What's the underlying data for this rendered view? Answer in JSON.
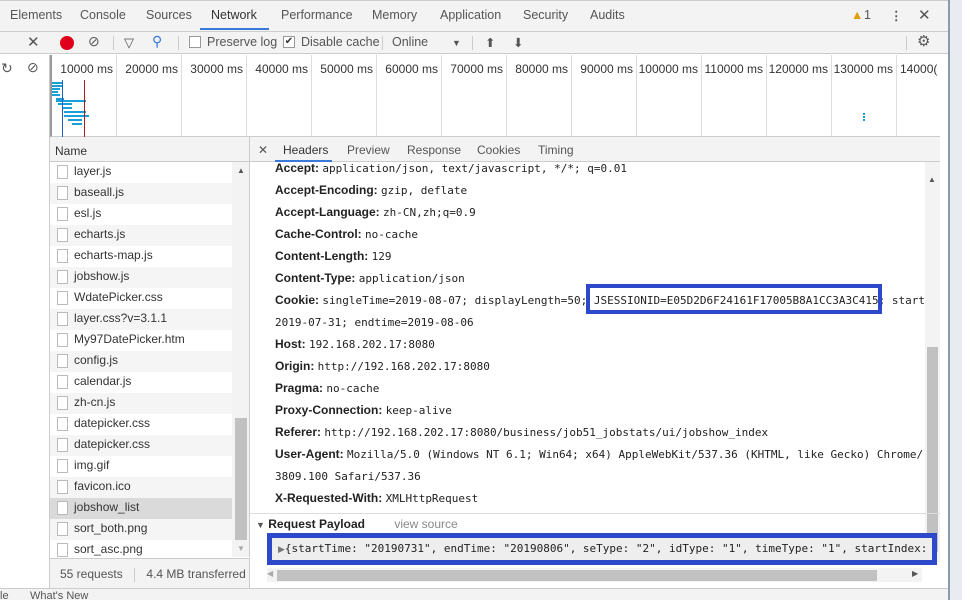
{
  "tabs": [
    "Elements",
    "Console",
    "Sources",
    "Network",
    "Performance",
    "Memory",
    "Application",
    "Security",
    "Audits"
  ],
  "active_tab": "Network",
  "warning_count": "1",
  "toolbar": {
    "preserve_log": "Preserve log",
    "preserve_log_checked": false,
    "disable_cache": "Disable cache",
    "disable_cache_checked": true,
    "throttle": "Online"
  },
  "colors": {
    "accent": "#3879d9",
    "record": "#e0001b",
    "highlight_box": "#2d48c8"
  },
  "timeline_ticks": [
    "10000 ms",
    "20000 ms",
    "30000 ms",
    "40000 ms",
    "50000 ms",
    "60000 ms",
    "70000 ms",
    "80000 ms",
    "90000 ms",
    "100000 ms",
    "110000 ms",
    "120000 ms",
    "130000 ms",
    "14000("
  ],
  "name_header": "Name",
  "requests": [
    "layer.js",
    "baseall.js",
    "esl.js",
    "echarts.js",
    "echarts-map.js",
    "jobshow.js",
    "WdatePicker.css",
    "layer.css?v=3.1.1",
    "My97DatePicker.htm",
    "config.js",
    "calendar.js",
    "zh-cn.js",
    "datepicker.css",
    "datepicker.css",
    "img.gif",
    "favicon.ico",
    "jobshow_list",
    "sort_both.png",
    "sort_asc.png"
  ],
  "selected_request": "jobshow_list",
  "status": {
    "requests": "55 requests",
    "transferred": "4.4 MB transferred"
  },
  "detail_tabs": [
    "Headers",
    "Preview",
    "Response",
    "Cookies",
    "Timing"
  ],
  "headers": [
    {
      "k": "Accept:",
      "v": "application/json, text/javascript, */*; q=0.01"
    },
    {
      "k": "Accept-Encoding:",
      "v": "gzip, deflate"
    },
    {
      "k": "Accept-Language:",
      "v": "zh-CN,zh;q=0.9"
    },
    {
      "k": "Cache-Control:",
      "v": "no-cache"
    },
    {
      "k": "Content-Length:",
      "v": "129"
    },
    {
      "k": "Content-Type:",
      "v": "application/json"
    },
    {
      "k": "Cookie:",
      "v": "singleTime=2019-08-07; displayLength=50; JSESSIONID=E05D2D6F24161F17005B8A1CC3A3C415; start"
    },
    {
      "k": "",
      "v": "2019-07-31; endtime=2019-08-06"
    },
    {
      "k": "Host:",
      "v": "192.168.202.17:8080"
    },
    {
      "k": "Origin:",
      "v": "http://192.168.202.17:8080"
    },
    {
      "k": "Pragma:",
      "v": "no-cache"
    },
    {
      "k": "Proxy-Connection:",
      "v": "keep-alive"
    },
    {
      "k": "Referer:",
      "v": "http://192.168.202.17:8080/business/job51_jobstats/ui/jobshow_index"
    },
    {
      "k": "User-Agent:",
      "v": "Mozilla/5.0 (Windows NT 6.1; Win64; x64) AppleWebKit/537.36 (KHTML, like Gecko) Chrome/"
    },
    {
      "k": "",
      "v": "3809.100 Safari/537.36"
    },
    {
      "k": "X-Requested-With:",
      "v": "XMLHttpRequest"
    }
  ],
  "payload": {
    "title": "Request Payload",
    "view_source": "view source",
    "value": "{startTime: \"20190731\", endTime: \"20190806\", seType: \"2\", idType: \"1\", timeType: \"1\", startIndex:"
  },
  "drawer": {
    "tab1": "le",
    "tab2": "What's New"
  }
}
